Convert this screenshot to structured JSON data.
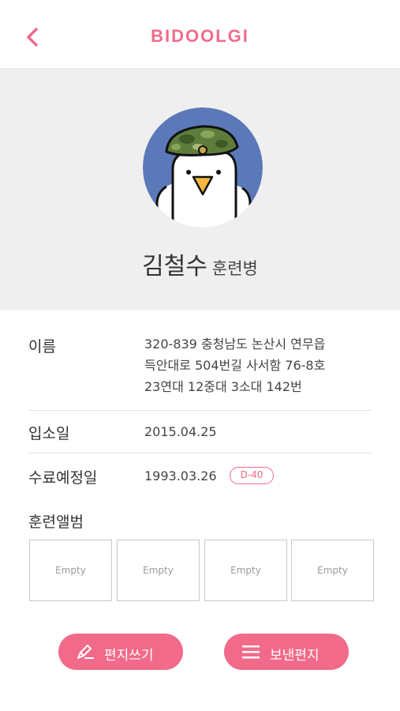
{
  "header": {
    "title": "BIDOOLGI",
    "back_icon": "chevron-left-icon",
    "accent_color": "#f06b8a"
  },
  "profile": {
    "name": "김철수",
    "rank": "훈련병",
    "avatar_icon": "pigeon-soldier-avatar"
  },
  "info": {
    "address_label": "이름",
    "address_lines": [
      "320-839 충청남도 논산시 연무읍",
      "득안대로 504번길 사서함 76-8호",
      "23연대 12중대 3소대 142번"
    ],
    "enlist_label": "입소일",
    "enlist_date": "2015.04.25",
    "graduation_label": "수료예정일",
    "graduation_date": "1993.03.26",
    "dday": "D-40"
  },
  "album": {
    "title": "훈련앨범",
    "slots": [
      "Empty",
      "Empty",
      "Empty",
      "Empty"
    ]
  },
  "actions": {
    "write_label": "편지쓰기",
    "write_icon": "pencil-icon",
    "sent_label": "보낸편지",
    "sent_icon": "list-icon"
  }
}
